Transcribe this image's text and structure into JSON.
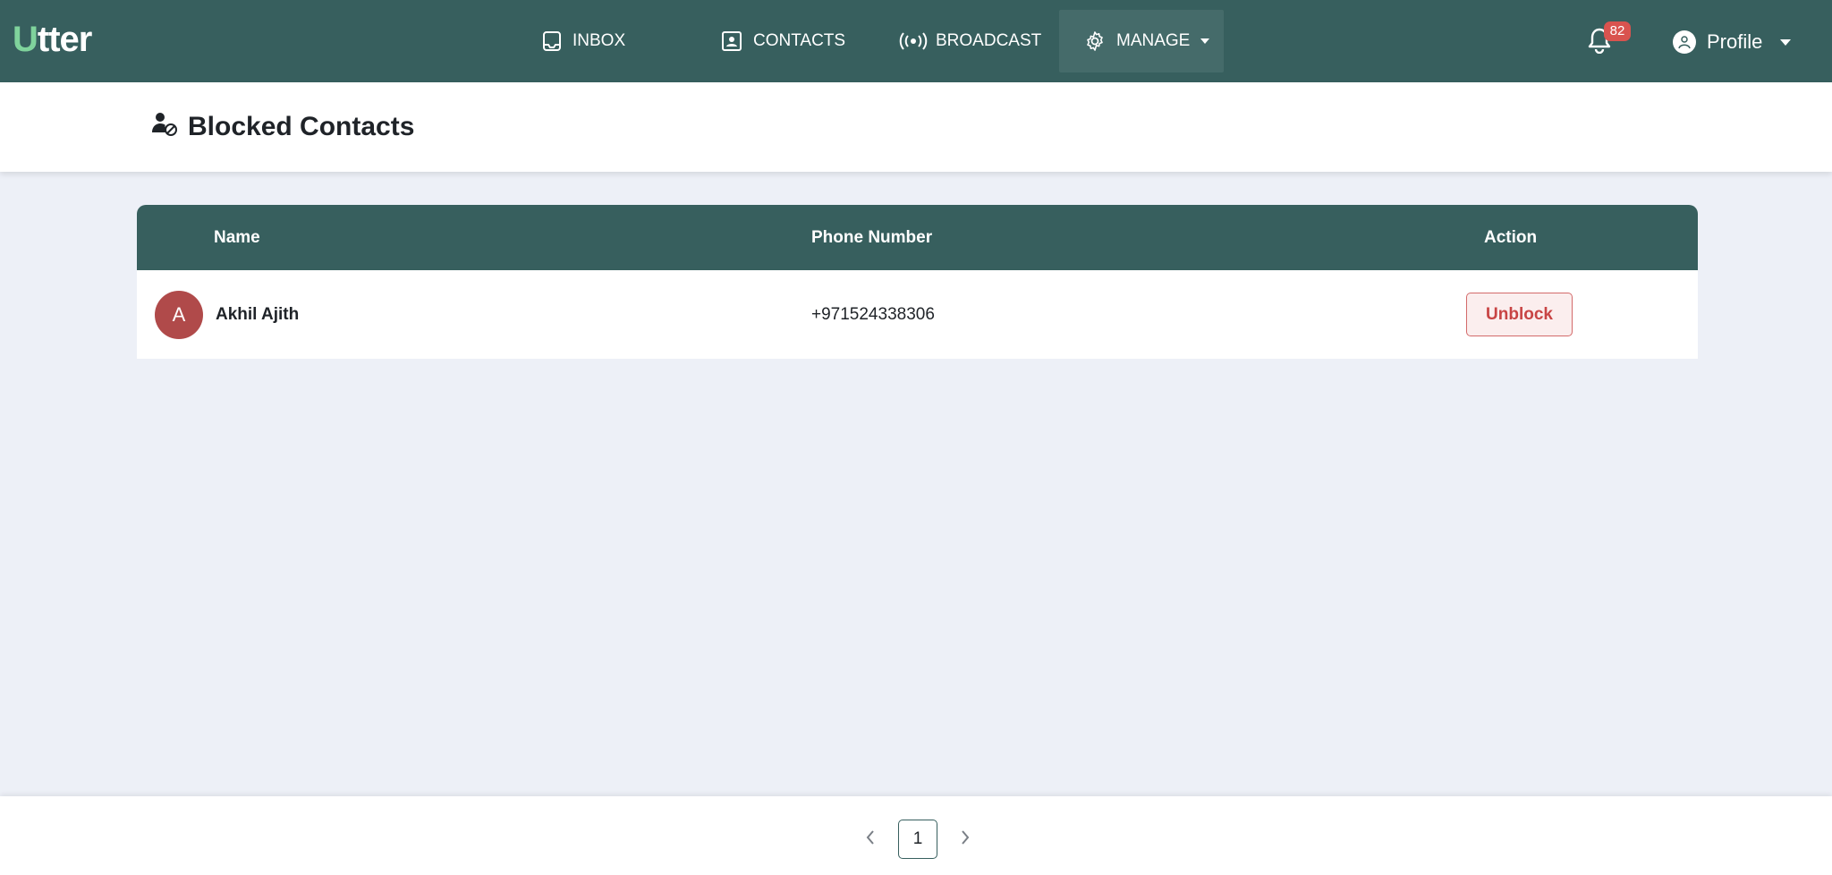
{
  "app": {
    "logo_first": "U",
    "logo_rest": "tter"
  },
  "nav": {
    "items": [
      {
        "label": "INBOX",
        "icon": "inbox-icon"
      },
      {
        "label": "CONTACTS",
        "icon": "contact-card-icon"
      },
      {
        "label": "BROADCAST",
        "icon": "broadcast-icon"
      },
      {
        "label": "MANAGE",
        "icon": "gear-icon",
        "active": true,
        "has_dropdown": true
      }
    ],
    "notifications_count": "82",
    "profile_label": "Profile"
  },
  "page": {
    "title": "Blocked Contacts",
    "title_icon": "user-blocked-icon"
  },
  "table": {
    "columns": [
      "Name",
      "Phone Number",
      "Action"
    ],
    "rows": [
      {
        "initial": "A",
        "name": "Akhil Ajith",
        "phone": "+971524338306",
        "action_label": "Unblock"
      }
    ]
  },
  "pagination": {
    "current_page": "1"
  },
  "colors": {
    "brand": "#375f5e",
    "logo_accent": "#7fd39c",
    "badge": "#d9534f",
    "avatar": "#b04a4a",
    "danger": "#c84444",
    "background": "#edf0f7"
  }
}
